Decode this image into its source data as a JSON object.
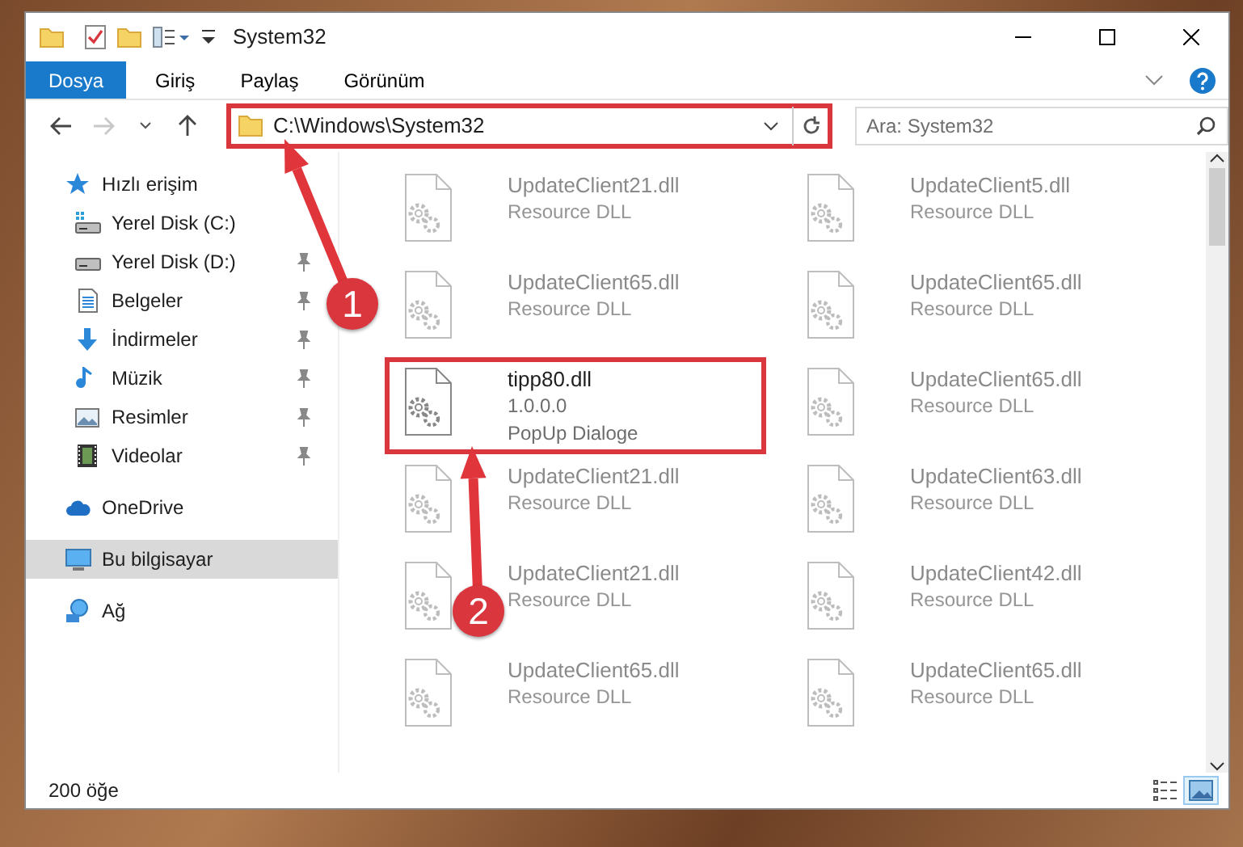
{
  "window": {
    "title": "System32"
  },
  "ribbon_tabs": [
    {
      "label": "Dosya",
      "kind": "file",
      "selected": false
    },
    {
      "label": "Giriş",
      "kind": "tab",
      "selected": false
    },
    {
      "label": "Paylaş",
      "kind": "tab",
      "selected": false
    },
    {
      "label": "Görünüm",
      "kind": "tab",
      "selected": false
    }
  ],
  "address_bar": {
    "path": "C:\\Windows\\System32",
    "highlighted": true
  },
  "search": {
    "placeholder": "Ara: System32"
  },
  "sidebar": {
    "items": [
      {
        "label": "Hızlı erişim",
        "kind": "quick",
        "selected": false,
        "children": [
          {
            "label": "Yerel Disk (C:)",
            "kind": "disk-c",
            "pinned": false
          },
          {
            "label": "Yerel Disk (D:)",
            "kind": "disk",
            "pinned": true
          },
          {
            "label": "Belgeler",
            "kind": "documents",
            "pinned": true
          },
          {
            "label": "İndirmeler",
            "kind": "downloads",
            "pinned": true
          },
          {
            "label": "Müzik",
            "kind": "music",
            "pinned": true
          },
          {
            "label": "Resimler",
            "kind": "pictures",
            "pinned": true
          },
          {
            "label": "Videolar",
            "kind": "videos",
            "pinned": true
          }
        ]
      },
      {
        "label": "OneDrive",
        "kind": "cloud",
        "selected": false
      },
      {
        "label": "Bu bilgisayar",
        "kind": "computer",
        "selected": true
      },
      {
        "label": "Ağ",
        "kind": "network",
        "selected": false
      }
    ]
  },
  "files": [
    {
      "name": "UpdateClient21.dll",
      "lines": [
        "Resource DLL"
      ],
      "dimmed": true,
      "highlighted": false
    },
    {
      "name": "UpdateClient5.dll",
      "lines": [
        "Resource DLL"
      ],
      "dimmed": true,
      "highlighted": false
    },
    {
      "name": "UpdateClient65.dll",
      "lines": [
        "Resource DLL"
      ],
      "dimmed": true,
      "highlighted": false
    },
    {
      "name": "UpdateClient65.dll",
      "lines": [
        "Resource DLL"
      ],
      "dimmed": true,
      "highlighted": false
    },
    {
      "name": "tipp80.dll",
      "lines": [
        "1.0.0.0",
        "PopUp Dialoge"
      ],
      "dimmed": false,
      "highlighted": true
    },
    {
      "name": "UpdateClient65.dll",
      "lines": [
        "Resource DLL"
      ],
      "dimmed": true,
      "highlighted": false
    },
    {
      "name": "UpdateClient21.dll",
      "lines": [
        "Resource DLL"
      ],
      "dimmed": true,
      "highlighted": false
    },
    {
      "name": "UpdateClient63.dll",
      "lines": [
        "Resource DLL"
      ],
      "dimmed": true,
      "highlighted": false
    },
    {
      "name": "UpdateClient21.dll",
      "lines": [
        "Resource DLL"
      ],
      "dimmed": true,
      "highlighted": false
    },
    {
      "name": "UpdateClient42.dll",
      "lines": [
        "Resource DLL"
      ],
      "dimmed": true,
      "highlighted": false
    },
    {
      "name": "UpdateClient65.dll",
      "lines": [
        "Resource DLL"
      ],
      "dimmed": true,
      "highlighted": false
    },
    {
      "name": "UpdateClient65.dll",
      "lines": [
        "Resource DLL"
      ],
      "dimmed": true,
      "highlighted": false
    }
  ],
  "status_bar": {
    "count": "200 öğe"
  },
  "views": [
    {
      "kind": "details",
      "selected": false
    },
    {
      "kind": "tiles",
      "selected": true
    }
  ],
  "annotations": [
    {
      "number": "1"
    },
    {
      "number": "2"
    }
  ]
}
